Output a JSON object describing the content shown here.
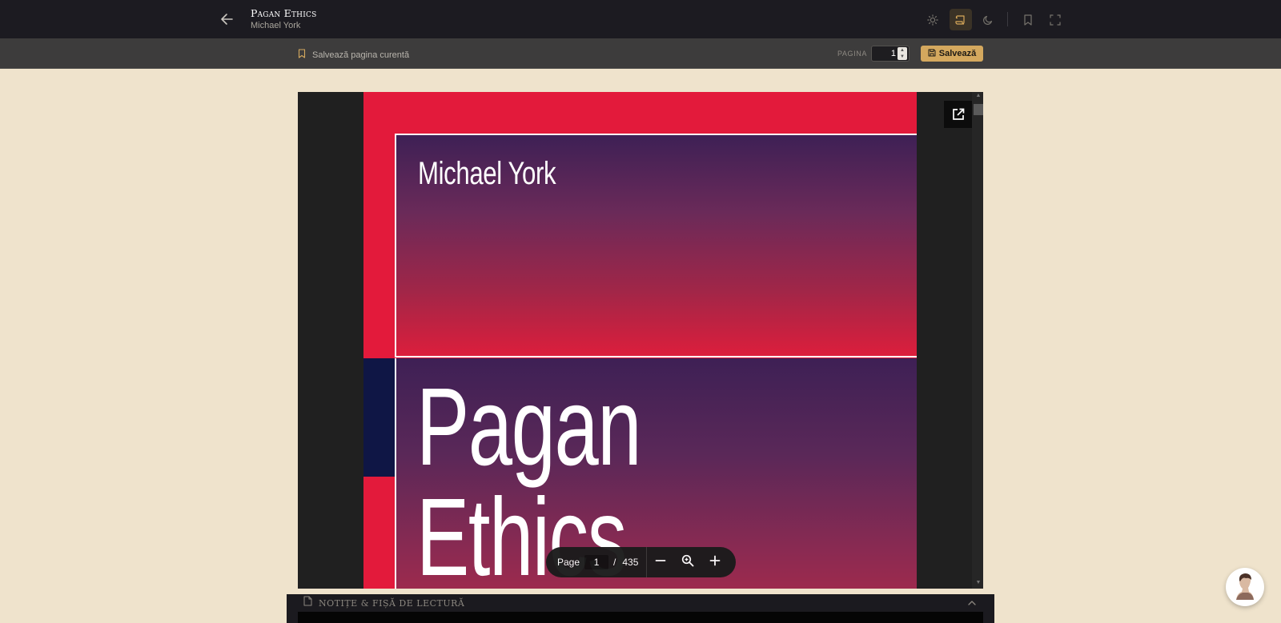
{
  "header": {
    "title": "Pagan Ethics",
    "author": "Michael York",
    "icons": [
      "back-arrow-icon",
      "sun-icon",
      "scroll-icon",
      "moon-icon",
      "bookmark-icon",
      "fullscreen-icon"
    ]
  },
  "subbar": {
    "save_current_label": "Salvează pagina curentă",
    "page_label": "PAGINA",
    "page_value": "1",
    "save_button_label": "Salvează"
  },
  "cover": {
    "author": "Michael York",
    "title": "Pagan\nEthics"
  },
  "pdf_toolbar": {
    "page_label": "Page",
    "current_page": "1",
    "separator": "/",
    "total_pages": "435"
  },
  "notes": {
    "title": "Notițe & Fișă de lectură"
  },
  "colors": {
    "accent": "#d4a85e",
    "topbar": "#1c1b21",
    "background": "#efe3cc",
    "cover_red": "#e31a3b",
    "cover_purple": "#3e2055"
  }
}
